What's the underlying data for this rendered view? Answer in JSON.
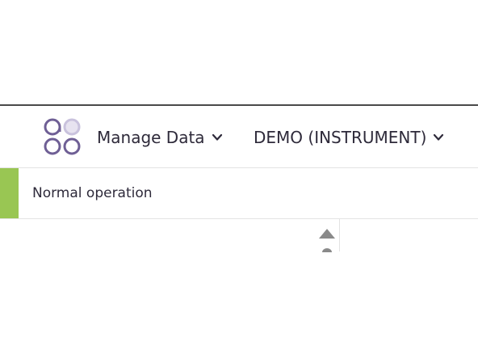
{
  "header": {
    "menu_manage_label": "Manage Data",
    "menu_instrument_label": "DEMO (INSTRUMENT)"
  },
  "status": {
    "text": "Normal operation",
    "accent_color": "#99c653"
  },
  "icons": {
    "logo": "four-circles-logo-icon",
    "menu_chevron": "chevron-down-icon",
    "scroll_up": "triangle-up-icon"
  },
  "colors": {
    "brand_purple": "#6f5f95",
    "brand_lavender": "#c9c2dd",
    "text": "#2e2a3a"
  }
}
